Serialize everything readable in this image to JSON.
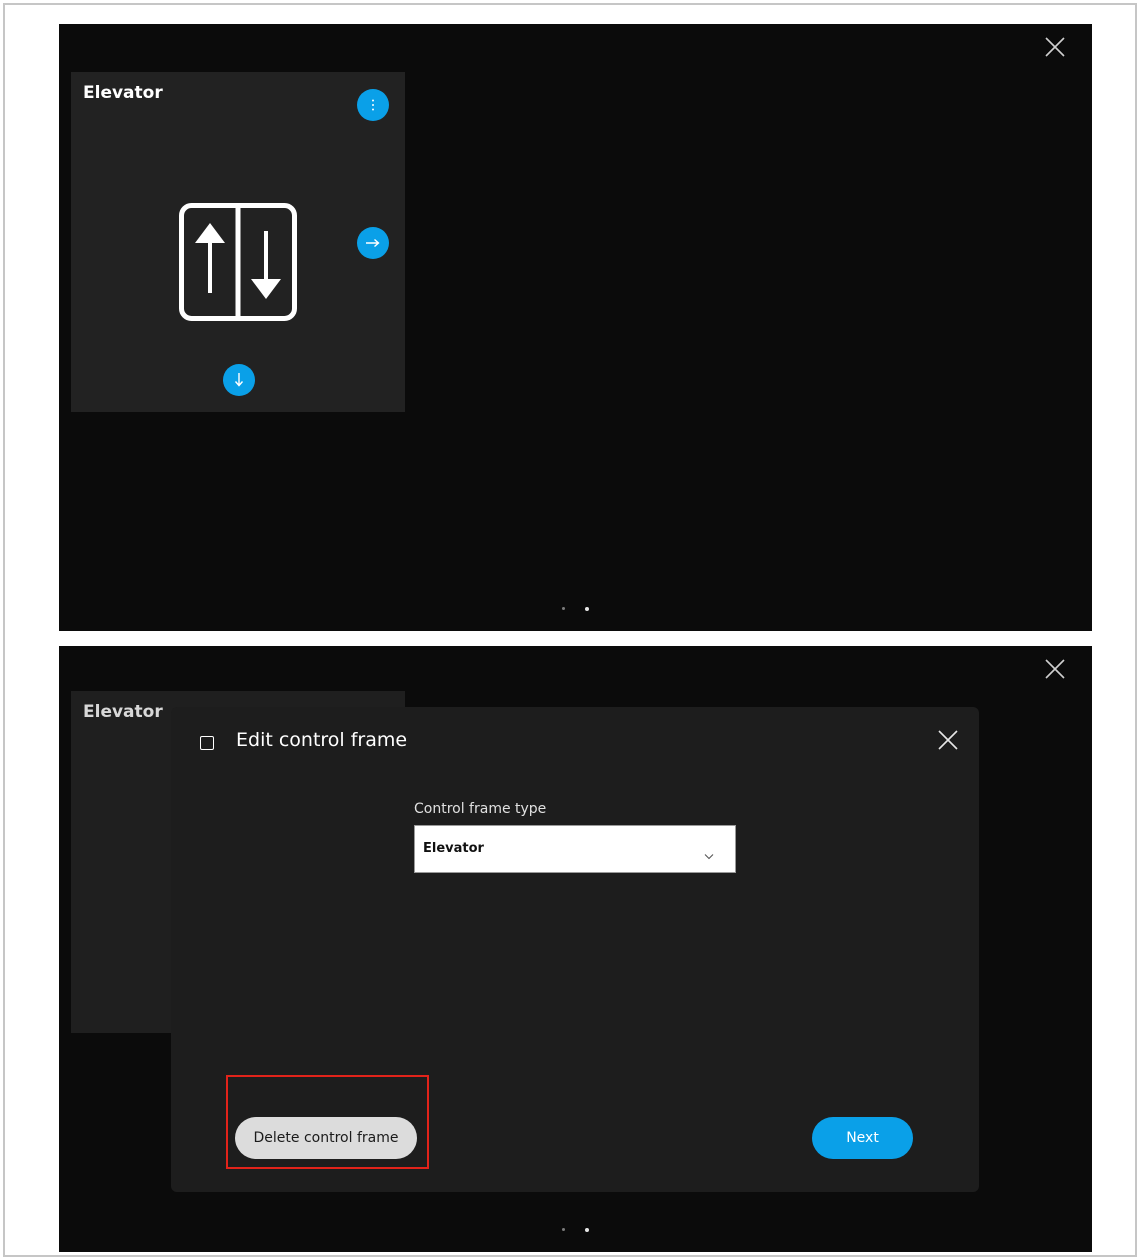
{
  "screen1": {
    "tile": {
      "title": "Elevator"
    },
    "icons": {
      "close": "close-icon",
      "menu": "more-vertical-icon",
      "right": "arrow-right-icon",
      "down": "arrow-down-icon",
      "elevator": "elevator-icon"
    },
    "pagination": {
      "count": 2,
      "active_index": 1
    }
  },
  "screen2": {
    "background_tile": {
      "title": "Elevator"
    },
    "dialog": {
      "title": "Edit control frame",
      "field_label": "Control frame type",
      "select_value": "Elevator",
      "delete_button": "Delete control frame",
      "next_button": "Next"
    },
    "pagination": {
      "count": 2,
      "active_index": 1
    }
  },
  "colors": {
    "accent": "#0aa0e8",
    "screen_background": "#0b0b0b",
    "tile_background": "#222222",
    "highlight": "#e2231a"
  }
}
